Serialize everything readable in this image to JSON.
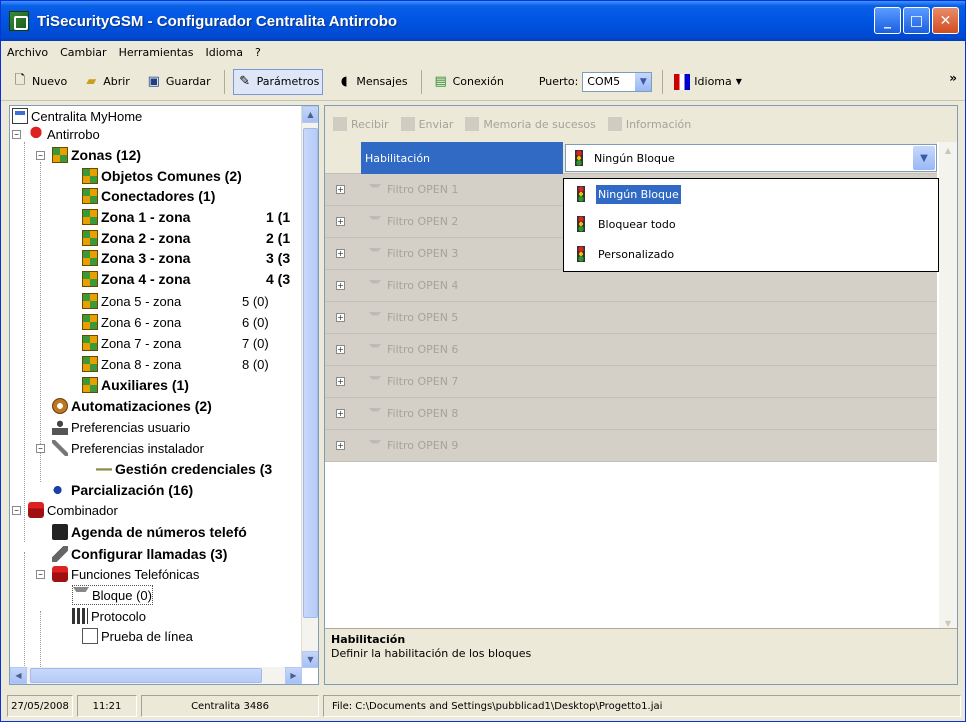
{
  "window": {
    "title": "TiSecurityGSM - Configurador Centralita Antirrobo"
  },
  "menu": [
    "Archivo",
    "Cambiar",
    "Herramientas",
    "Idioma",
    "?"
  ],
  "toolbar": {
    "nuevo": "Nuevo",
    "abrir": "Abrir",
    "guardar": "Guardar",
    "parametros": "Parámetros",
    "mensajes": "Mensajes",
    "conexion": "Conexión",
    "puerto_label": "Puerto:",
    "puerto_value": "COM5",
    "idioma": "Idioma",
    "more": "»"
  },
  "tree": {
    "root": "Centralita MyHome",
    "antirrobo": "Antirrobo",
    "zonas": "Zonas (12)",
    "objetos": "Objetos Comunes (2)",
    "conectadores": "Conectadores (1)",
    "zona1": "Zona 1 - zona",
    "zona1_count": "1 (1",
    "zona2": "Zona 2 - zona",
    "zona2_count": "2 (1",
    "zona3": "Zona 3 - zona",
    "zona3_count": "3 (3",
    "zona4": "Zona 4 - zona",
    "zona4_count": "4 (3",
    "zona5": "Zona 5 - zona",
    "zona5_count": "5 (0)",
    "zona6": "Zona 6 - zona",
    "zona6_count": "6 (0)",
    "zona7": "Zona 7 - zona",
    "zona7_count": "7 (0)",
    "zona8": "Zona 8 - zona",
    "zona8_count": "8 (0)",
    "auxiliares": "Auxiliares (1)",
    "automatizaciones": "Automatizaciones (2)",
    "pref_usuario": "Preferencias usuario",
    "pref_instalador": "Preferencias instalador",
    "gestion": "Gestión credenciales (3",
    "parcializacion": "Parcialización (16)",
    "combinador": "Combinador",
    "agenda": "Agenda de números telefó",
    "configurar": "Configurar llamadas (3)",
    "funciones": "Funciones Telefónicas",
    "bloque": "Bloque (0)",
    "protocolo": "Protocolo",
    "prueba": "Prueba de línea"
  },
  "right_toolbar": [
    "Recibir",
    "Enviar",
    "Memoria de sucesos",
    "Información"
  ],
  "property": {
    "label": "Habilitación",
    "value": "Ningún Bloque",
    "options": [
      "Ningún Bloque",
      "Bloquear todo",
      "Personalizado"
    ]
  },
  "filters": [
    "Filtro OPEN 1",
    "Filtro OPEN 2",
    "Filtro OPEN 3",
    "Filtro OPEN 4",
    "Filtro OPEN 5",
    "Filtro OPEN 6",
    "Filtro OPEN 7",
    "Filtro OPEN 8",
    "Filtro OPEN 9"
  ],
  "description": {
    "title": "Habilitación",
    "text": "Definir la habilitación de los bloques"
  },
  "status": {
    "date": "27/05/2008",
    "time": "11:21",
    "centralita": "Centralita 3486",
    "file": "File: C:\\Documents and Settings\\pubblicad1\\Desktop\\Progetto1.jai"
  },
  "colors": {
    "titlebar": "#0054e3",
    "selection": "#316ac5",
    "face": "#ece9d8"
  }
}
